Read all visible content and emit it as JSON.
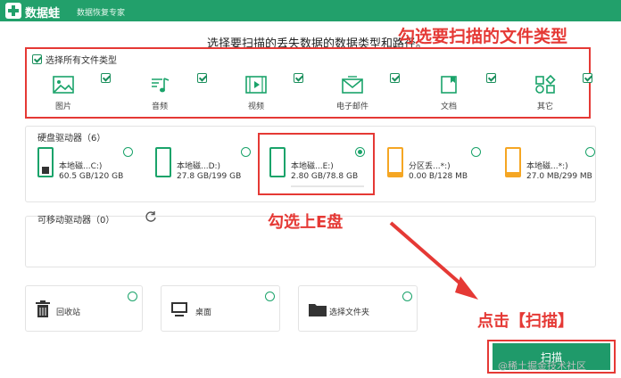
{
  "app": {
    "name": "数据蛙",
    "subtitle": "数据恢复专家"
  },
  "headline": "选择要扫描的丢失数据的数据类型和路径。",
  "annotations": {
    "select_types": "勾选要扫描的文件类型",
    "select_e": "勾选上E盘",
    "click_scan": "点击【扫描】"
  },
  "file_types": {
    "select_all_label": "选择所有文件类型",
    "items": [
      {
        "label": "图片",
        "icon": "image-icon",
        "checked": true
      },
      {
        "label": "音频",
        "icon": "music-icon",
        "checked": true
      },
      {
        "label": "视频",
        "icon": "video-icon",
        "checked": true
      },
      {
        "label": "电子邮件",
        "icon": "email-icon",
        "checked": true
      },
      {
        "label": "文档",
        "icon": "document-icon",
        "checked": true
      },
      {
        "label": "其它",
        "icon": "other-icon",
        "checked": true
      }
    ]
  },
  "hard_drives": {
    "title": "硬盘驱动器（6）",
    "drives": [
      {
        "name": "本地磁...C:)",
        "size": "60.5 GB/120 GB",
        "selected": false,
        "color": "#1aa36a"
      },
      {
        "name": "本地磁...D:)",
        "size": "27.8 GB/199 GB",
        "selected": false,
        "color": "#1aa36a"
      },
      {
        "name": "本地磁...E:)",
        "size": "2.80 GB/78.8 GB",
        "selected": true,
        "color": "#1aa36a"
      },
      {
        "name": "分区丢...*:)",
        "size": "0.00  B/128 MB",
        "selected": false,
        "color": "#f5a623"
      },
      {
        "name": "本地磁...*:)",
        "size": "27.0 MB/299 MB",
        "selected": false,
        "color": "#f5a623"
      }
    ]
  },
  "removable": {
    "title": "可移动驱动器（0）"
  },
  "quick": {
    "recycle": "回收站",
    "desktop": "桌面",
    "folder": "选择文件夹"
  },
  "scan_button": "扫描",
  "watermark": "@稀土掘金技术社区",
  "colors": {
    "brand": "#22a06b",
    "annotation": "#e53935",
    "button": "#1f9a6a"
  }
}
